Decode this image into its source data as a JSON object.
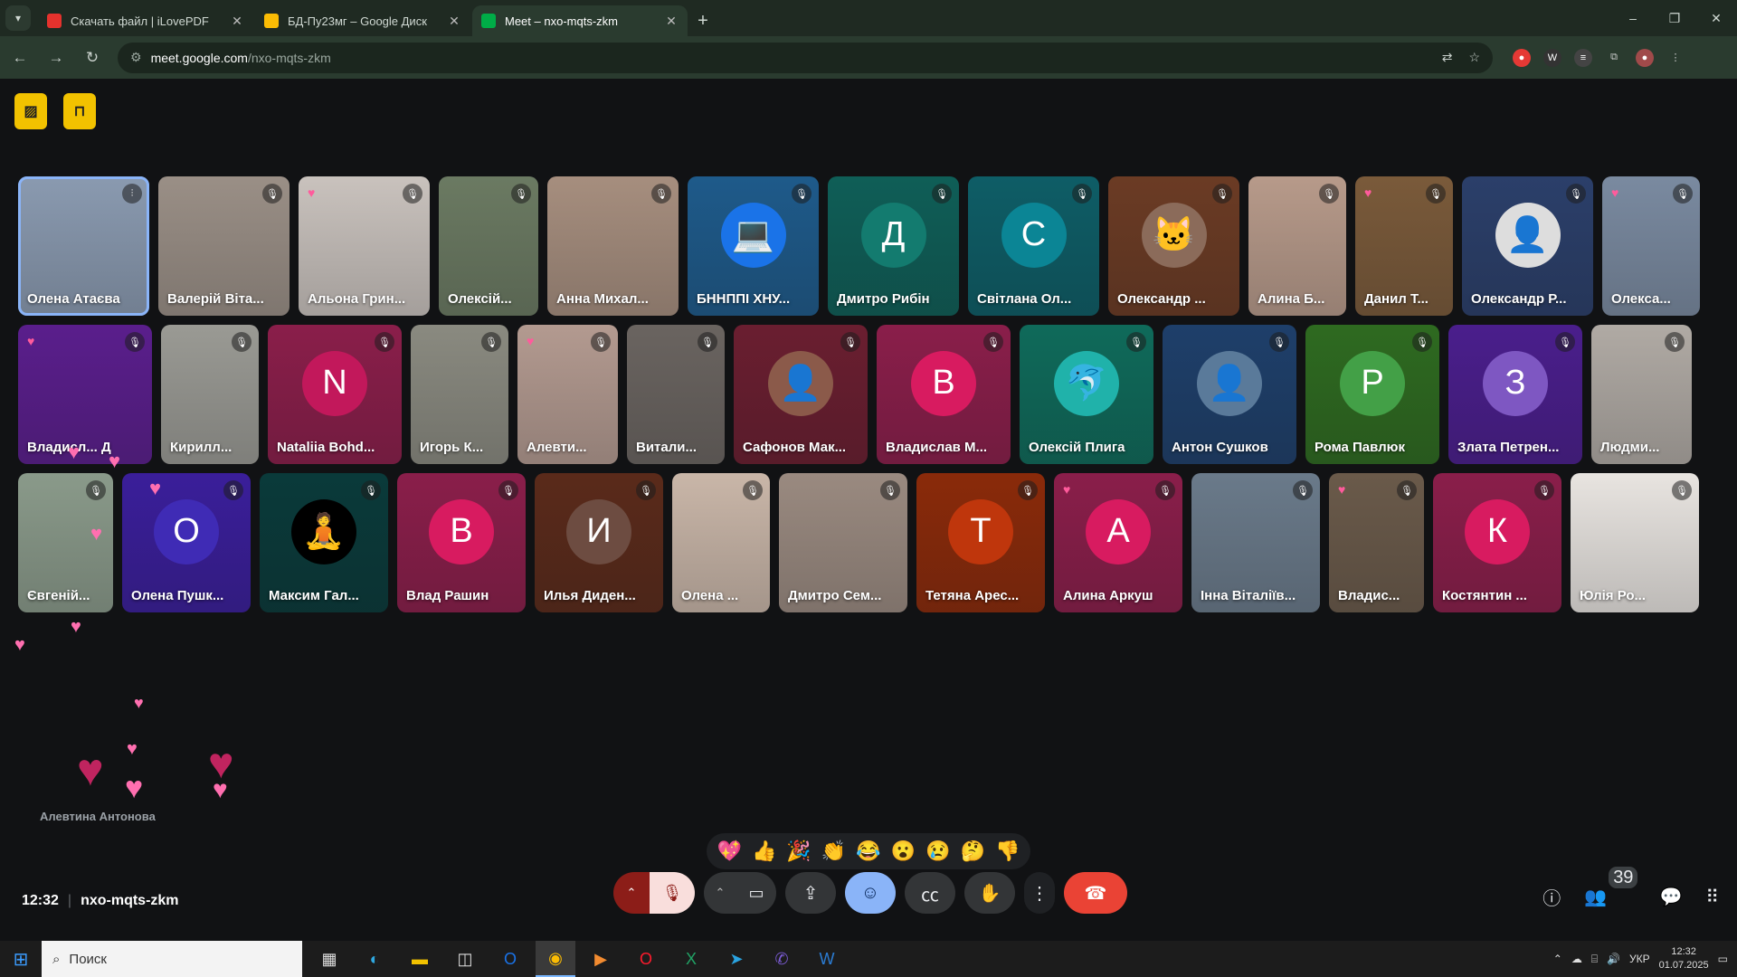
{
  "browser": {
    "tabs": [
      {
        "title": "Скачать файл | iLovePDF",
        "color": "#e5322d",
        "active": false
      },
      {
        "title": "БД-Пу23мг – Google Диск",
        "color": "#fbbc04",
        "active": false
      },
      {
        "title": "Meet – nxo-mqts-zkm",
        "color": "#00ac47",
        "active": true
      }
    ],
    "url_host": "meet.google.com",
    "url_path": "/nxo-mqts-zkm"
  },
  "participants_row1": [
    {
      "name": "Олена Атаєва",
      "bg": "#8a9ab0",
      "avatar": "",
      "speaking": true
    },
    {
      "name": "Валерій Віта...",
      "bg": "#9a8f86",
      "avatar": ""
    },
    {
      "name": "Альона Грин...",
      "bg": "#c9c2bd",
      "avatar": "",
      "heart": true
    },
    {
      "name": "Олексій...",
      "bg": "#6b7a62",
      "avatar": ""
    },
    {
      "name": "Анна Михал...",
      "bg": "#a68e7e",
      "avatar": ""
    },
    {
      "name": "БННППІ ХНУ...",
      "bg": "#1e5a8a",
      "avatar": "💻",
      "avatarbg": "#1a73e8"
    },
    {
      "name": "Дмитро Рибін",
      "bg": "#0f5e57",
      "avatar": "Д",
      "avatarbg": "#137b6f"
    },
    {
      "name": "Світлана Ол...",
      "bg": "#0e5d66",
      "avatar": "С",
      "avatarbg": "#0b8595"
    },
    {
      "name": "Олександр ...",
      "bg": "#6b3b24",
      "avatar": "🐱",
      "avatarbg": "#8b6b5a"
    },
    {
      "name": "Алина Б...",
      "bg": "#b79a8a",
      "avatar": ""
    },
    {
      "name": "Данил Т...",
      "bg": "#7a5a3a",
      "avatar": "",
      "heart": true
    },
    {
      "name": "Олександр Р...",
      "bg": "#2b3f6a",
      "avatar": "👤",
      "avatarbg": "#ddd"
    },
    {
      "name": "Олекса...",
      "bg": "#7a8aa0",
      "avatar": "",
      "heart": true
    }
  ],
  "participants_row2": [
    {
      "name": "Владисл... Д",
      "bg": "#5a1e8c",
      "avatar": "",
      "heart": true
    },
    {
      "name": "Кирилл...",
      "bg": "#9a9a94",
      "avatar": ""
    },
    {
      "name": "Nataliia Bohd...",
      "bg": "#8a1e4a",
      "avatar": "N",
      "avatarbg": "#c2185b"
    },
    {
      "name": "Игорь К...",
      "bg": "#8a8a80",
      "avatar": ""
    },
    {
      "name": "Алевти...",
      "bg": "#b39a90",
      "avatar": "",
      "heart": true
    },
    {
      "name": "Витали...",
      "bg": "#6a6460",
      "avatar": ""
    },
    {
      "name": "Сафонов Мак...",
      "bg": "#6a1e30",
      "avatar": "👤",
      "avatarbg": "#8b5a4a"
    },
    {
      "name": "Владислав М...",
      "bg": "#8a1e4a",
      "avatar": "В",
      "avatarbg": "#d81b60"
    },
    {
      "name": "Олексій Плига",
      "bg": "#0f6a5a",
      "avatar": "🐬",
      "avatarbg": "#20b2aa"
    },
    {
      "name": "Антон Сушков",
      "bg": "#1e3f6a",
      "avatar": "👤",
      "avatarbg": "#5a7a9a"
    },
    {
      "name": "Рома Павлюк",
      "bg": "#2e6a20",
      "avatar": "Р",
      "avatarbg": "#43a047"
    },
    {
      "name": "Злата Петрен...",
      "bg": "#4a1e8c",
      "avatar": "З",
      "avatarbg": "#7e57c2"
    },
    {
      "name": "Людми...",
      "bg": "#b0aaa4",
      "avatar": ""
    }
  ],
  "participants_row3": [
    {
      "name": "Євгеній...",
      "bg": "#8a9a8a",
      "avatar": ""
    },
    {
      "name": "Олена Пушк...",
      "bg": "#3a1e9a",
      "avatar": "О",
      "avatarbg": "#3f2bb5"
    },
    {
      "name": "Максим Гал...",
      "bg": "#0a3a3a",
      "avatar": "🧘",
      "avatarbg": "#000"
    },
    {
      "name": "Влад Рашин",
      "bg": "#8a1e4a",
      "avatar": "В",
      "avatarbg": "#d81b60"
    },
    {
      "name": "Илья Диден...",
      "bg": "#5a2a1a",
      "avatar": "И",
      "avatarbg": "#6d4c41"
    },
    {
      "name": "Олена ...",
      "bg": "#c9b6a8",
      "avatar": ""
    },
    {
      "name": "Дмитро Сем...",
      "bg": "#9a8a80",
      "avatar": ""
    },
    {
      "name": "Тетяна Арес...",
      "bg": "#8a2a0a",
      "avatar": "Т",
      "avatarbg": "#bf360c"
    },
    {
      "name": "Алина Аркуш",
      "bg": "#8a1e4a",
      "avatar": "А",
      "avatarbg": "#d81b60",
      "heart": true
    },
    {
      "name": "Інна Віталіїв...",
      "bg": "#6a7a8a",
      "avatar": ""
    },
    {
      "name": "Владис...",
      "bg": "#6a5a4a",
      "avatar": "",
      "heart": true
    },
    {
      "name": "Костянтин ...",
      "bg": "#8a1e4a",
      "avatar": "К",
      "avatarbg": "#d81b60"
    },
    {
      "name": "Юлія Ро...",
      "bg": "#e8e4e0",
      "avatar": ""
    }
  ],
  "floating_reaction_name": "Алевтина Антонова",
  "reactions": [
    "💖",
    "👍",
    "🎉",
    "👏",
    "😂",
    "😮",
    "😢",
    "🤔",
    "👎"
  ],
  "meeting": {
    "time": "12:32",
    "code": "nxo-mqts-zkm",
    "participant_count": "39"
  },
  "taskbar": {
    "search_placeholder": "Поиск",
    "lang": "УКР",
    "time": "12:32",
    "date": "01.07.2025"
  }
}
